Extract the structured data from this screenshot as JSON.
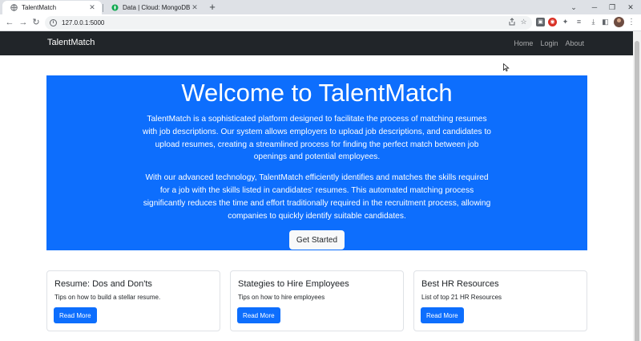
{
  "browser": {
    "tabs": [
      {
        "title": "TalentMatch",
        "active": true,
        "icon": "globe-icon"
      },
      {
        "title": "Data | Cloud: MongoDB Cloud",
        "active": false,
        "icon": "mongodb-leaf-icon"
      }
    ],
    "new_tab_label": "+",
    "url": "127.0.0.1:5000"
  },
  "navbar": {
    "brand": "TalentMatch",
    "links": [
      "Home",
      "Login",
      "About"
    ]
  },
  "hero": {
    "title": "Welcome to TalentMatch",
    "paragraph1": "TalentMatch is a sophisticated platform designed to facilitate the process of matching resumes with job descriptions. Our system allows employers to upload job descriptions, and candidates to upload resumes, creating a streamlined process for finding the perfect match between job openings and potential employees.",
    "paragraph2": "With our advanced technology, TalentMatch efficiently identifies and matches the skills required for a job with the skills listed in candidates' resumes. This automated matching process significantly reduces the time and effort traditionally required in the recruitment process, allowing companies to quickly identify suitable candidates.",
    "cta": "Get Started"
  },
  "cards": [
    {
      "title": "Resume: Dos and Don'ts",
      "text": "Tips on how to build a stellar resume.",
      "button": "Read More"
    },
    {
      "title": "Stategies to Hire Employees",
      "text": "Tips on how to hire employees",
      "button": "Read More"
    },
    {
      "title": "Best HR Resources",
      "text": "List of top 21 HR Resources",
      "button": "Read More"
    }
  ],
  "colors": {
    "primary": "#0d6efd",
    "navbar": "#212529",
    "chrome": "#dee1e6"
  }
}
